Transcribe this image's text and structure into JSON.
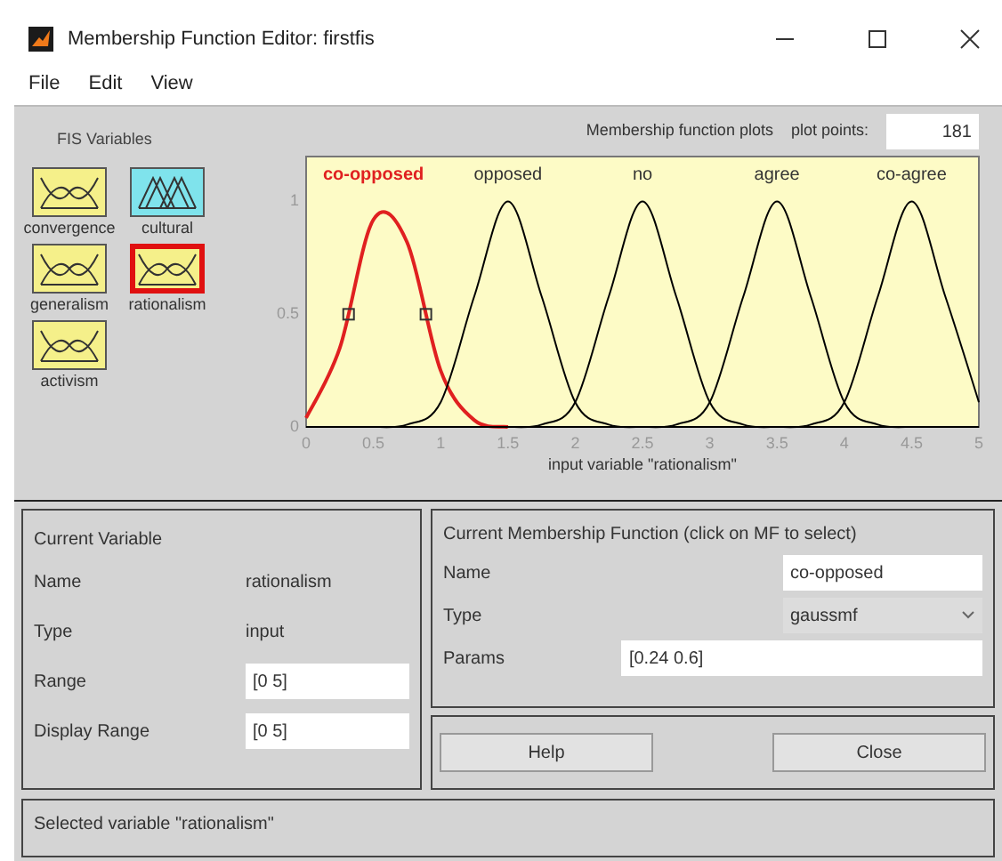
{
  "window": {
    "title": "Membership Function Editor: firstfis"
  },
  "menu": [
    "File",
    "Edit",
    "View"
  ],
  "fis_variables": {
    "title": "FIS Variables",
    "items": [
      {
        "name": "convergence",
        "kind": "input",
        "selected": false
      },
      {
        "name": "cultural",
        "kind": "output",
        "selected": false
      },
      {
        "name": "generalism",
        "kind": "input",
        "selected": false
      },
      {
        "name": "rationalism",
        "kind": "input",
        "selected": true
      },
      {
        "name": "activism",
        "kind": "input",
        "selected": false
      }
    ]
  },
  "plot_header": {
    "title": "Membership function plots",
    "plot_points_label": "plot points:",
    "plot_points": "181"
  },
  "chart_data": {
    "type": "line",
    "xlabel": "input variable \"rationalism\"",
    "x": [
      0,
      0.25,
      0.5,
      0.75,
      1,
      1.25,
      1.5,
      1.75,
      2,
      2.25,
      2.5,
      2.75,
      3,
      3.25,
      3.5,
      3.75,
      4,
      4.25,
      4.5,
      4.75,
      5
    ],
    "series": [
      {
        "name": "co-opposed",
        "color": "#e02020",
        "values": [
          0.04,
          0.35,
          0.92,
          0.82,
          0.25,
          0.03,
          0,
          null,
          null,
          null,
          null,
          null,
          null,
          null,
          null,
          null,
          null,
          null,
          null,
          null,
          null
        ]
      },
      {
        "name": "opposed",
        "color": "#000000",
        "values": [
          null,
          null,
          0,
          0.01,
          0.11,
          0.58,
          1,
          0.58,
          0.11,
          0.01,
          0,
          null,
          null,
          null,
          null,
          null,
          null,
          null,
          null,
          null,
          null
        ]
      },
      {
        "name": "no",
        "color": "#000000",
        "values": [
          null,
          null,
          null,
          null,
          null,
          null,
          0,
          0.01,
          0.11,
          0.58,
          1,
          0.58,
          0.11,
          0.01,
          0,
          null,
          null,
          null,
          null,
          null,
          null
        ]
      },
      {
        "name": "agree",
        "color": "#000000",
        "values": [
          null,
          null,
          null,
          null,
          null,
          null,
          null,
          null,
          null,
          null,
          0,
          0.01,
          0.11,
          0.58,
          1,
          0.58,
          0.11,
          0.01,
          0,
          null,
          null
        ]
      },
      {
        "name": "co-agree",
        "color": "#000000",
        "values": [
          null,
          null,
          null,
          null,
          null,
          null,
          null,
          null,
          null,
          null,
          null,
          null,
          null,
          null,
          0,
          0.01,
          0.11,
          0.58,
          1,
          0.58,
          0.11
        ]
      }
    ],
    "xlim": [
      0,
      5
    ],
    "ylim": [
      0,
      1.2
    ],
    "xticks": [
      0,
      0.5,
      1,
      1.5,
      2,
      2.5,
      3,
      3.5,
      4,
      4.5,
      5
    ],
    "yticks": [
      0,
      0.5,
      1
    ]
  },
  "current_variable": {
    "title": "Current Variable",
    "name_label": "Name",
    "name": "rationalism",
    "type_label": "Type",
    "type": "input",
    "range_label": "Range",
    "range": "[0 5]",
    "display_range_label": "Display Range",
    "display_range": "[0 5]"
  },
  "current_mf": {
    "title": "Current Membership Function (click on MF to select)",
    "name_label": "Name",
    "name": "co-opposed",
    "type_label": "Type",
    "type": "gaussmf",
    "params_label": "Params",
    "params": "[0.24 0.6]"
  },
  "buttons": [
    "Help",
    "Close"
  ],
  "status_bar": "Selected variable \"rationalism\""
}
